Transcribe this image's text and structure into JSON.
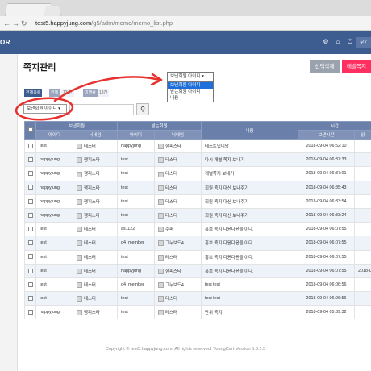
{
  "browser": {
    "url_host": "test5.happyjung.com",
    "url_path": "/g5/adm/memo/memo_list.php"
  },
  "header": {
    "brand": "OR",
    "right_button": "부7"
  },
  "page": {
    "title": "쪽지관리",
    "delete_button": "선택삭제",
    "send_button": "레벨쪽지"
  },
  "counts": {
    "all": "전체목록",
    "total_label": "전체",
    "total_value": "13 건",
    "read_label": "미열람",
    "read_value": "13건"
  },
  "search": {
    "field_value": "보낸회원 아이디"
  },
  "dropdown": {
    "selected": "보낸회원 아이디",
    "options": [
      "보낸회원 아이디",
      "받는회원 아이디",
      "내용"
    ]
  },
  "table": {
    "group_headers": [
      "보낸회원",
      "받는회원",
      "내용",
      "시간"
    ],
    "sub_headers": [
      "아이디",
      "닉네임",
      "아이디",
      "닉네임",
      "보낸시간",
      "읽"
    ],
    "rows": [
      {
        "from_id": "test",
        "from_nick": "테스터",
        "to_id": "happyjung",
        "to_nick": "행피스타",
        "content": "테스트입니당",
        "sent": "2018-09-04 06:52:10",
        "read": ""
      },
      {
        "from_id": "happyjung",
        "from_nick": "행피스타",
        "to_id": "test",
        "to_nick": "테스터",
        "content": "다시 개별 쪽지 보내기",
        "sent": "2018-09-04 06:37:33",
        "read": ""
      },
      {
        "from_id": "happyjung",
        "from_nick": "행피스타",
        "to_id": "test",
        "to_nick": "테스터",
        "content": "개별쪽지 보내기",
        "sent": "2018-09-04 06:37:01",
        "read": ""
      },
      {
        "from_id": "happyjung",
        "from_nick": "행피스타",
        "to_id": "test",
        "to_nick": "테스터",
        "content": "회원 쪽지 대신 보내주기",
        "sent": "2018-09-04 06:35:43",
        "read": ""
      },
      {
        "from_id": "happyjung",
        "from_nick": "행피스타",
        "to_id": "test",
        "to_nick": "테스터",
        "content": "회원 쪽지 대신 보내주기",
        "sent": "2018-09-04 06:33:54",
        "read": ""
      },
      {
        "from_id": "happyjung",
        "from_nick": "행피스타",
        "to_id": "test",
        "to_nick": "테스터",
        "content": "회원 쪽지 대신 보내주기",
        "sent": "2018-09-04 06:33:24",
        "read": ""
      },
      {
        "from_id": "test",
        "from_nick": "테스터",
        "to_id": "as1122",
        "to_nick": "수퍼",
        "content": "홍보 쪽지 다윤다윤을 이다.",
        "sent": "2018-09-04 06:07:55",
        "read": ""
      },
      {
        "from_id": "test",
        "from_nick": "테스터",
        "to_id": "g4_member",
        "to_nick": "그누보드4",
        "content": "홍보 쪽지 다윤다윤을 이다.",
        "sent": "2018-09-04 06:07:55",
        "read": ""
      },
      {
        "from_id": "test",
        "from_nick": "테스터",
        "to_id": "test",
        "to_nick": "테스터",
        "content": "홍보 쪽지 다윤다윤을 이다.",
        "sent": "2018-09-04 06:07:55",
        "read": ""
      },
      {
        "from_id": "test",
        "from_nick": "테스터",
        "to_id": "happyjung",
        "to_nick": "행피스타",
        "content": "홍보 쪽지 다윤다윤을 이다.",
        "sent": "2018-09-04 06:07:55",
        "read": "2018-0"
      },
      {
        "from_id": "test",
        "from_nick": "테스터",
        "to_id": "g4_member",
        "to_nick": "그누보드4",
        "content": "test test",
        "sent": "2018-09-04 06:06:56",
        "read": ""
      },
      {
        "from_id": "test",
        "from_nick": "테스터",
        "to_id": "test",
        "to_nick": "테스터",
        "content": "test test",
        "sent": "2018-09-04 06:06:56",
        "read": ""
      },
      {
        "from_id": "happyjung",
        "from_nick": "행피스타",
        "to_id": "test",
        "to_nick": "테스터",
        "content": "단위 쪽지",
        "sent": "2018-09-04 05:39:32",
        "read": ""
      }
    ]
  },
  "footer": {
    "text": "Copyright © test5.happyjung.com. All rights reserved. YoungCart Version 5.3.1.5"
  },
  "colors": {
    "header_bg": "#3d5c90",
    "table_header": "#6a80ab",
    "delete_btn": "#9aa2ad",
    "send_btn": "#ff3061",
    "annotation_red": "#e8302e"
  },
  "icons": [
    "back-arrow-icon",
    "forward-arrow-icon",
    "reload-icon",
    "gear-icon",
    "home-icon",
    "power-icon",
    "search-icon",
    "dropdown-arrow-icon"
  ]
}
